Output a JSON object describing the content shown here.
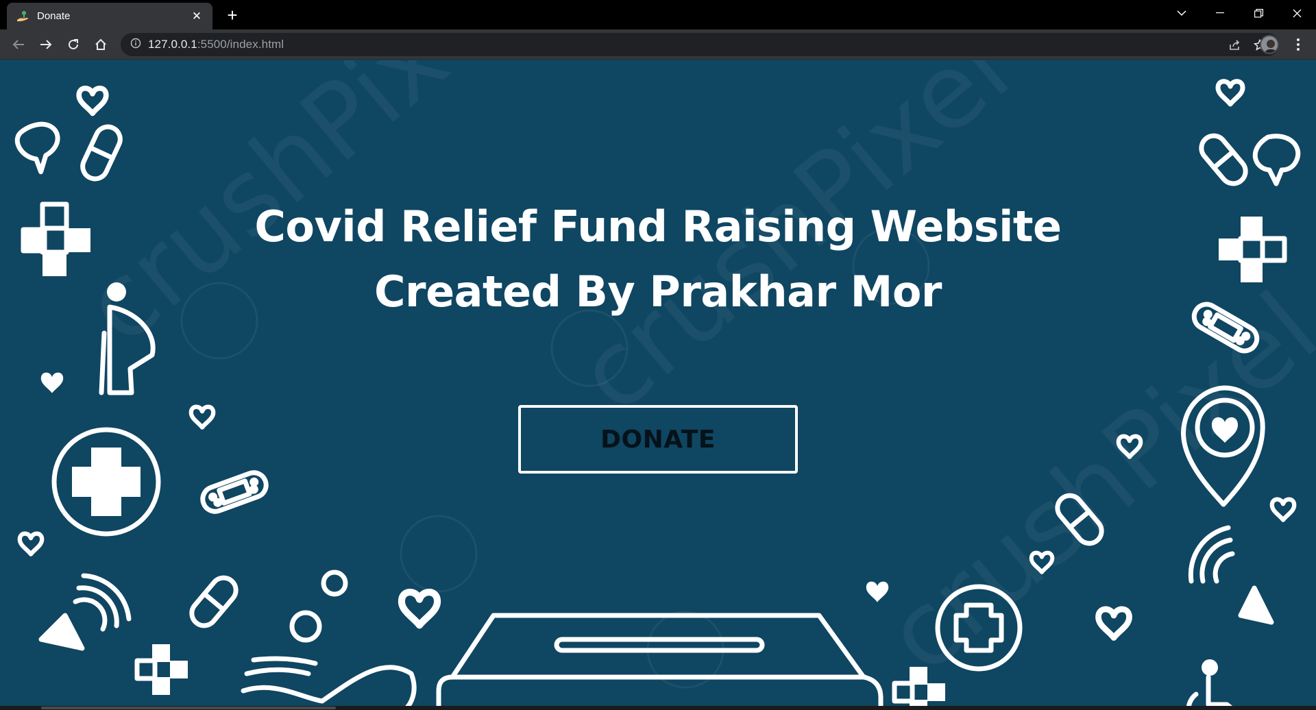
{
  "browser": {
    "tab": {
      "title": "Donate",
      "favicon": "donate-hand-icon"
    },
    "url": {
      "host": "127.0.0.1",
      "rest": ":5500/index.html"
    },
    "icons": [
      "back-arrow-icon",
      "forward-arrow-icon",
      "reload-icon",
      "home-icon",
      "site-info-icon",
      "share-icon",
      "bookmark-star-icon",
      "profile-avatar",
      "menu-dots-icon"
    ],
    "window_controls": [
      "tab-search-chevron",
      "minimize",
      "restore",
      "close"
    ]
  },
  "page": {
    "title_line1": "Covid Relief Fund Raising Website",
    "title_line2": "Created By Prakhar Mor",
    "donate_button": "DONATE",
    "colors": {
      "background": "#0f4662",
      "foreground": "#ffffff",
      "button_text": "#05121a"
    },
    "decor": [
      "heart-icon",
      "chat-bubble-icon",
      "pill-icon",
      "medical-cross-icon",
      "elderly-person-icon",
      "bandage-icon",
      "circle-cross-icon",
      "megaphone-icon",
      "location-heart-pin-icon",
      "open-hand-icon",
      "donation-box-icon",
      "wheelchair-icon"
    ]
  }
}
